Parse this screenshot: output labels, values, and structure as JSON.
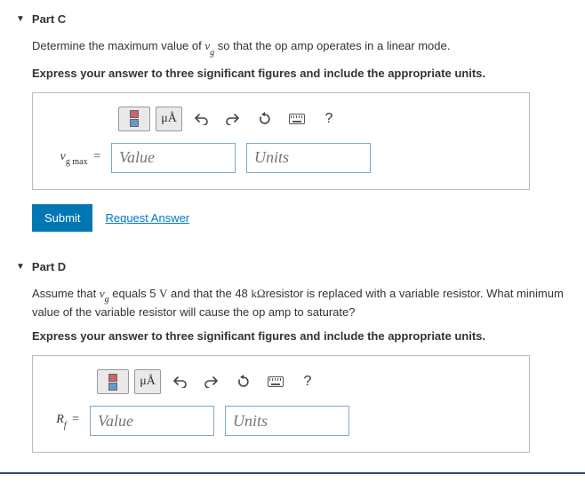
{
  "partC": {
    "title": "Part C",
    "prompt_pre": "Determine the maximum value of ",
    "prompt_var": "v",
    "prompt_sub": "g",
    "prompt_post": " so that the op amp operates in a linear mode.",
    "instruction": "Express your answer to three significant figures and include the appropriate units.",
    "toolbar": {
      "mu": "μÅ",
      "help": "?"
    },
    "var": "v",
    "var_sub": "g max",
    "eq": " =",
    "value_placeholder": "Value",
    "units_placeholder": "Units",
    "submit": "Submit",
    "request": "Request Answer"
  },
  "partD": {
    "title": "Part D",
    "prompt_pre": "Assume that ",
    "prompt_var": "v",
    "prompt_sub": "g",
    "prompt_mid1": " equals 5 ",
    "prompt_v": "V",
    "prompt_mid2": " and that the 48 ",
    "prompt_kohm": "kΩ",
    "prompt_post": "resistor is replaced with a variable resistor. What minimum value of the variable resistor will cause the op amp to saturate?",
    "instruction": "Express your answer to three significant figures and include the appropriate units.",
    "toolbar": {
      "mu": "μÅ",
      "help": "?"
    },
    "var": "R",
    "var_sub": "f",
    "eq": " =",
    "value_placeholder": "Value",
    "units_placeholder": "Units"
  }
}
